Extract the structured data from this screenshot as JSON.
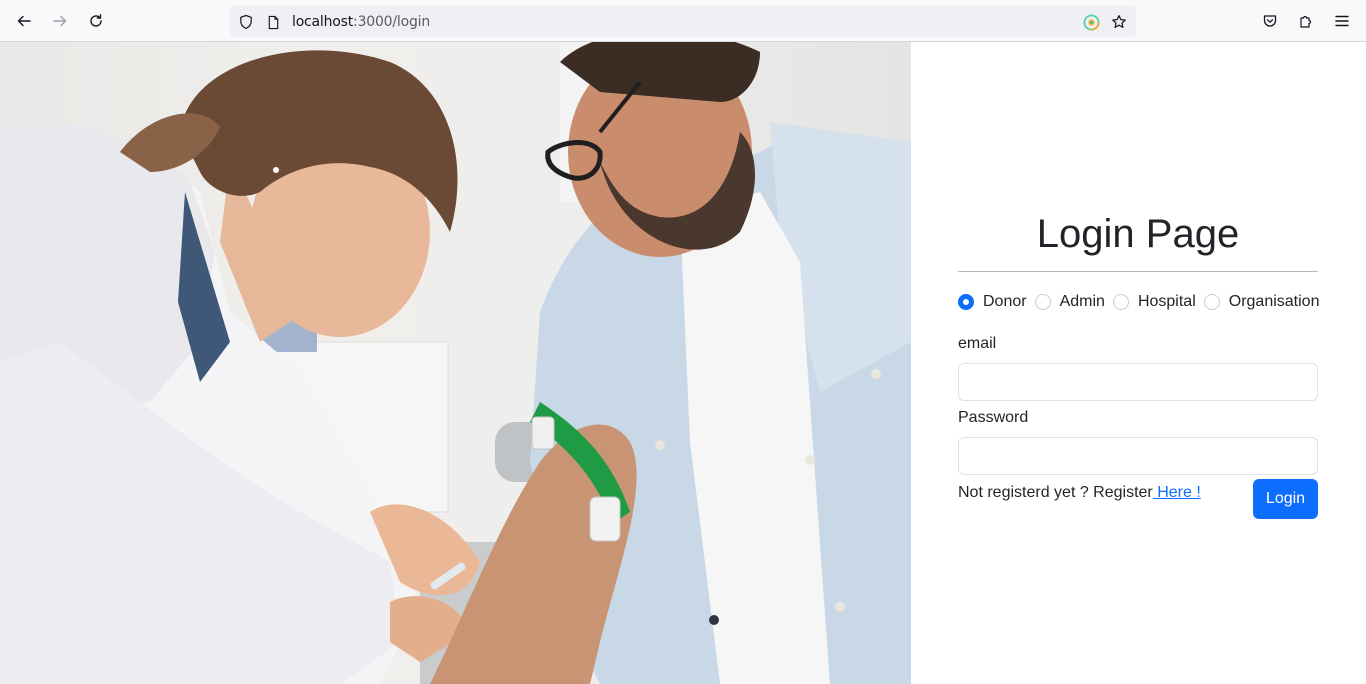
{
  "browser": {
    "url_host": "localhost",
    "url_path": ":3000/login"
  },
  "page": {
    "title": "Login Page",
    "roles": [
      "Donor",
      "Admin",
      "Hospital",
      "Organisation"
    ],
    "selected_role": "Donor",
    "email_label": "email",
    "email_value": "",
    "password_label": "Password",
    "password_value": "",
    "register_text": "Not registerd yet ? Register",
    "register_link": " Here !",
    "login_button": "Login"
  },
  "colors": {
    "primary": "#0d6efd",
    "text": "#212529"
  }
}
